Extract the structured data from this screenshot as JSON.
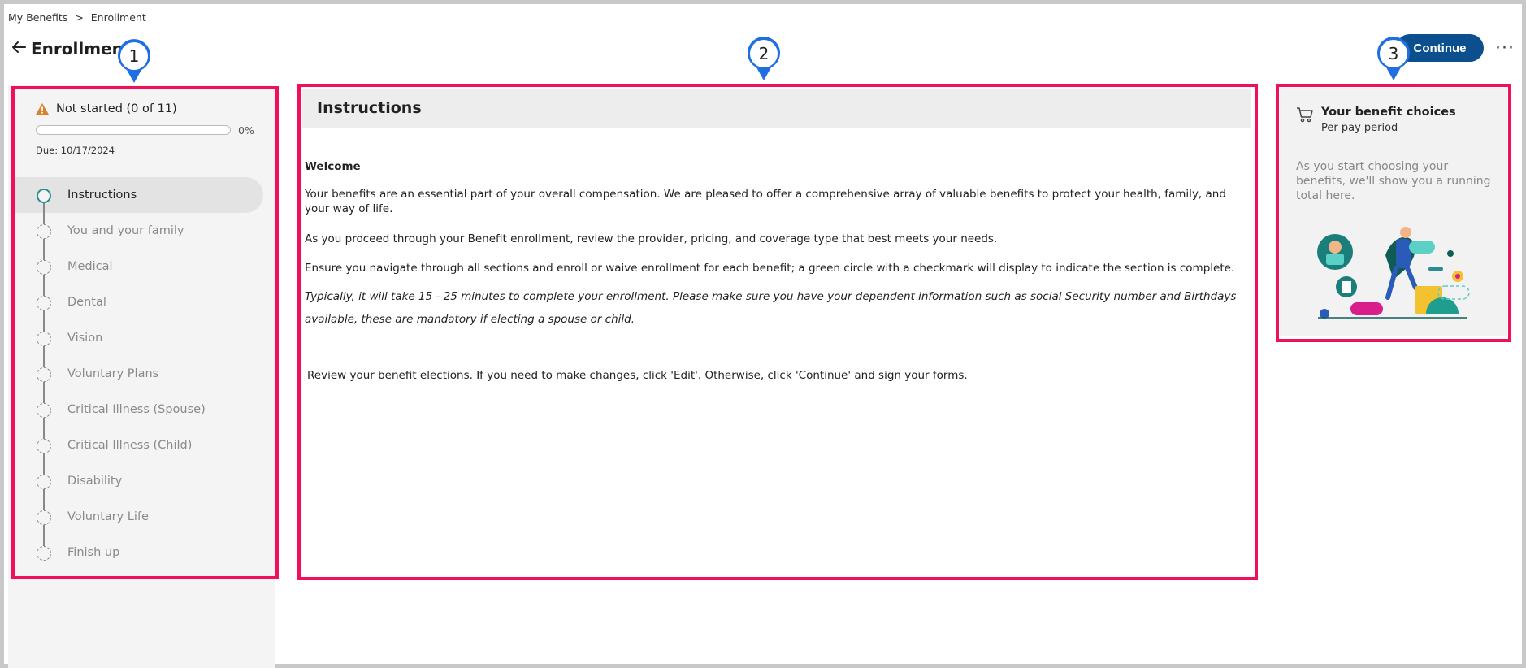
{
  "breadcrumb": {
    "items": [
      "My Benefits",
      ">",
      "Enrollment"
    ]
  },
  "header": {
    "title": "Enrollment",
    "continue_label": "Continue",
    "more_label": "···"
  },
  "annotations": [
    "1",
    "2",
    "3"
  ],
  "status": {
    "label": "Not started (0 of 11)",
    "progress_percent": 0,
    "progress_text": "0%",
    "due": "Due: 10/17/2024"
  },
  "steps": [
    {
      "label": "Instructions",
      "active": true
    },
    {
      "label": "You and your family",
      "active": false
    },
    {
      "label": "Medical",
      "active": false
    },
    {
      "label": "Dental",
      "active": false
    },
    {
      "label": "Vision",
      "active": false
    },
    {
      "label": "Voluntary Plans",
      "active": false
    },
    {
      "label": "Critical Illness (Spouse)",
      "active": false
    },
    {
      "label": "Critical Illness (Child)",
      "active": false
    },
    {
      "label": "Disability",
      "active": false
    },
    {
      "label": "Voluntary Life",
      "active": false
    },
    {
      "label": "Finish up",
      "active": false
    }
  ],
  "main": {
    "title": "Instructions",
    "welcome": "Welcome",
    "p1": "Your benefits are an essential part of your overall compensation. We are pleased to offer a comprehensive array of valuable benefits to protect your health, family, and your way of life.",
    "p2": "As you proceed through your Benefit enrollment, review the provider, pricing, and coverage type that best meets your needs.",
    "p3": "Ensure you navigate through all sections and enroll or waive enrollment for each benefit; a green circle with a checkmark will display to indicate the section is complete.",
    "p4": "Typically, it will take 15 - 25 minutes to complete your enrollment. Please make sure you have your dependent information such as social Security number and Birthdays available, these are mandatory if electing a spouse or child.",
    "p5": "Review your benefit elections. If you need to make changes, click 'Edit'. Otherwise, click 'Continue' and sign your forms."
  },
  "summary_card": {
    "title": "Your benefit choices",
    "subtitle": "Per pay period",
    "message": "As you start choosing your benefits, we'll show you a running total here."
  },
  "colors": {
    "accent": "#0b4f8f",
    "teal": "#2a8c93",
    "annotation": "#f0105a",
    "pin": "#1f6fe0",
    "warning": "#d9822b"
  }
}
